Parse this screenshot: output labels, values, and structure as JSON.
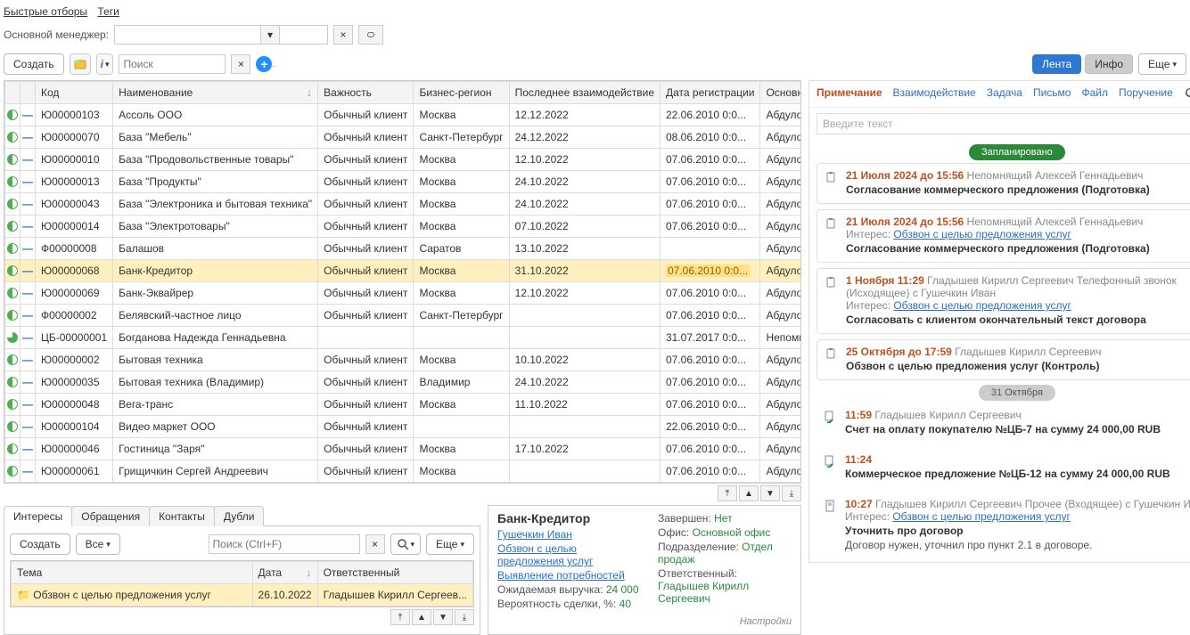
{
  "top_links": {
    "quick": "Быстрые отборы",
    "tags": "Теги"
  },
  "top_filter": {
    "label": "Основной менеджер:"
  },
  "toolbar": {
    "create": "Создать",
    "search_placeholder": "Поиск",
    "tab_lenta": "Лента",
    "tab_info": "Инфо",
    "more": "Еще"
  },
  "grid": {
    "cols": {
      "code": "Код",
      "name": "Наименование",
      "vaj": "Важность",
      "region": "Бизнес-регион",
      "last": "Последнее взаимодействие",
      "regdate": "Дата регистрации",
      "mgr": "Основной менеджер"
    },
    "rows": [
      {
        "s": "g",
        "code": "Ю00000103",
        "name": "Ассоль ООО",
        "vaj": "Обычный клиент",
        "region": "Москва",
        "last": "12.12.2022",
        "regdate": "22.06.2010 0:0...",
        "mgr": "Абдулов Юрий Влади..."
      },
      {
        "s": "g",
        "code": "Ю00000070",
        "name": "База \"Мебель\"",
        "vaj": "Обычный клиент",
        "region": "Санкт-Петербург",
        "last": "24.12.2022",
        "regdate": "08.06.2010 0:0...",
        "mgr": "Абдулов Юрий Влади..."
      },
      {
        "s": "g",
        "code": "Ю00000010",
        "name": "База \"Продовольственные товары\"",
        "vaj": "Обычный клиент",
        "region": "Москва",
        "last": "12.10.2022",
        "regdate": "07.06.2010 0:0...",
        "mgr": "Абдулов Юрий Влади..."
      },
      {
        "s": "g",
        "code": "Ю00000013",
        "name": "База \"Продукты\"",
        "vaj": "Обычный клиент",
        "region": "Москва",
        "last": "24.10.2022",
        "regdate": "07.06.2010 0:0...",
        "mgr": "Абдулов Юрий Влади..."
      },
      {
        "s": "g",
        "code": "Ю00000043",
        "name": "База \"Электроника и бытовая техника\"",
        "vaj": "Обычный клиент",
        "region": "Москва",
        "last": "24.10.2022",
        "regdate": "07.06.2010 0:0...",
        "mgr": "Абдулов Юрий Влади..."
      },
      {
        "s": "g",
        "code": "Ю00000014",
        "name": "База \"Электротовары\"",
        "vaj": "Обычный клиент",
        "region": "Москва",
        "last": "07.10.2022",
        "regdate": "07.06.2010 0:0...",
        "mgr": "Абдулов Юрий Влади..."
      },
      {
        "s": "g",
        "code": "Ф00000008",
        "name": "Балашов",
        "vaj": "Обычный клиент",
        "region": "Саратов",
        "last": "13.10.2022",
        "regdate": "",
        "mgr": "Абдулов Юрий Влади..."
      },
      {
        "s": "g",
        "code": "Ю00000068",
        "name": "Банк-Кредитор",
        "vaj": "Обычный клиент",
        "region": "Москва",
        "last": "31.10.2022",
        "regdate": "07.06.2010 0:0...",
        "mgr": "Абдулов Юрий Влади...",
        "sel": true,
        "warn": true
      },
      {
        "s": "g",
        "code": "Ю00000069",
        "name": "Банк-Эквайрер",
        "vaj": "Обычный клиент",
        "region": "Москва",
        "last": "12.10.2022",
        "regdate": "07.06.2010 0:0...",
        "mgr": "Абдулов Юрий Влади..."
      },
      {
        "s": "g",
        "code": "Ф00000002",
        "name": "Белявский-частное лицо",
        "vaj": "Обычный клиент",
        "region": "Санкт-Петербург",
        "last": "",
        "regdate": "07.06.2010 0:0...",
        "mgr": "Абдулов Юрий Влади..."
      },
      {
        "s": "q",
        "code": "ЦБ-00000001",
        "name": "Богданова Надежда Геннадьевна",
        "vaj": "",
        "region": "",
        "last": "",
        "regdate": "31.07.2017 0:0...",
        "mgr": "Непомнящий Алексей ..."
      },
      {
        "s": "g",
        "code": "Ю00000002",
        "name": "Бытовая техника",
        "vaj": "Обычный клиент",
        "region": "Москва",
        "last": "10.10.2022",
        "regdate": "07.06.2010 0:0...",
        "mgr": "Абдулов Юрий Влади..."
      },
      {
        "s": "g",
        "code": "Ю00000035",
        "name": "Бытовая техника (Владимир)",
        "vaj": "Обычный клиент",
        "region": "Владимир",
        "last": "24.10.2022",
        "regdate": "07.06.2010 0:0...",
        "mgr": "Абдулов Юрий Влади..."
      },
      {
        "s": "g",
        "code": "Ю00000048",
        "name": "Вега-транс",
        "vaj": "Обычный клиент",
        "region": "Москва",
        "last": "11.10.2022",
        "regdate": "07.06.2010 0:0...",
        "mgr": "Абдулов Юрий Влади..."
      },
      {
        "s": "g",
        "code": "Ю00000104",
        "name": "Видео маркет ООО",
        "vaj": "Обычный клиент",
        "region": "",
        "last": "",
        "regdate": "22.06.2010 0:0...",
        "mgr": "Абдулов Юрий Влади..."
      },
      {
        "s": "g",
        "code": "Ю00000046",
        "name": "Гостиница \"Заря\"",
        "vaj": "Обычный клиент",
        "region": "Москва",
        "last": "17.10.2022",
        "regdate": "07.06.2010 0:0...",
        "mgr": "Абдулов Юрий Влади..."
      },
      {
        "s": "g",
        "code": "Ю00000061",
        "name": "Грищичкин Сергей Андреевич",
        "vaj": "Обычный клиент",
        "region": "Москва",
        "last": "",
        "regdate": "07.06.2010 0:0...",
        "mgr": "Абдулов Юрий Влади..."
      }
    ]
  },
  "tabs": {
    "interests": "Интересы",
    "appeals": "Обращения",
    "contacts": "Контакты",
    "dupes": "Дубли"
  },
  "interests": {
    "create": "Создать",
    "all": "Все",
    "search_placeholder": "Поиск (Ctrl+F)",
    "more": "Еще",
    "cols": {
      "subject": "Тема",
      "date": "Дата",
      "resp": "Ответственный"
    },
    "rows": [
      {
        "subject": "Обзвон с целью предложения услуг",
        "date": "26.10.2022",
        "resp": "Гладышев Кирилл Сергеев..."
      }
    ]
  },
  "detail": {
    "title": "Банк-Кредитор",
    "contact": "Гушечкин Иван",
    "line1": "Обзвон с целью предложения услуг",
    "line2": "Выявление потребностей",
    "rev_lbl": "Ожидаемая выручка:",
    "rev_val": "24 000",
    "prob_lbl": "Вероятность сделки, %:",
    "prob_val": "40",
    "done_lbl": "Завершен:",
    "done_val": "Нет",
    "office_lbl": "Офис:",
    "office_val": "Основной офис",
    "dept_lbl": "Подразделение:",
    "dept_val": "Отдел продаж",
    "resp_lbl": "Ответственный:",
    "resp_val": "Гладышев Кирилл Сергеевич",
    "settings": "Настройки"
  },
  "feed": {
    "tabs": {
      "note": "Примечание",
      "interact": "Взаимодействие",
      "task": "Задача",
      "mail": "Письмо",
      "file": "Файл",
      "order": "Поручение"
    },
    "placeholder": "Введите текст",
    "sep_planned": "Запланировано",
    "sep_date": "31 Октября",
    "interest_prefix": "Интерес:",
    "interest_text": "Обзвон с целью предложения услуг",
    "cards": [
      {
        "icon": "clipboard",
        "date": "21 Июля 2024 до 15:56",
        "who": "Непомнящий Алексей Геннадьевич",
        "title": "Согласование коммерческого предложения (Подготовка)"
      },
      {
        "icon": "clipboard",
        "date": "21 Июля 2024 до 15:56",
        "who": "Непомнящий Алексей Геннадьевич",
        "link": true,
        "title": "Согласование коммерческого предложения (Подготовка)"
      },
      {
        "icon": "clipboard",
        "date": "1 Ноября 11:29",
        "who": "Гладышев Кирилл Сергеевич Телефонный звонок (Исходящее) с Гушечкин Иван",
        "link": true,
        "title": "Согласовать с клиентом окончательный текст договора"
      },
      {
        "icon": "clipboard",
        "date": "25 Октября до 17:59",
        "who": "Гладышев Кирилл Сергеевич",
        "title": "Обзвон с целью предложения услуг (Контроль)"
      }
    ],
    "done": [
      {
        "icon": "doc-check",
        "date": "11:59",
        "who": "Гладышев Кирилл Сергеевич",
        "title": "Счет на оплату покупателю №ЦБ-7 на сумму 24 000,00 RUB"
      },
      {
        "icon": "doc-check",
        "date": "11:24",
        "who": "",
        "title": "Коммерческое предложение №ЦБ-12 на сумму 24 000,00 RUB"
      },
      {
        "icon": "doc",
        "date": "10:27",
        "who": "Гладышев Кирилл Сергеевич Прочее (Входящее) с Гушечкин Иван",
        "link": true,
        "title": "Уточнить про договор",
        "sub": "Договор нужен, уточнил про пункт 2.1 в договоре."
      }
    ]
  }
}
